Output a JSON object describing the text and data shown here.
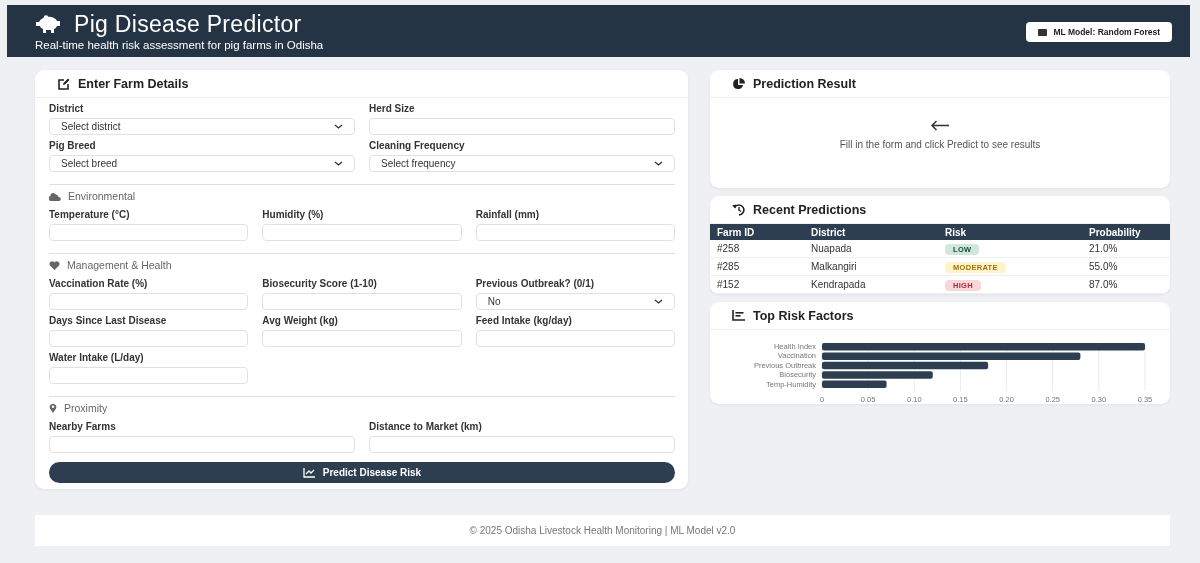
{
  "header": {
    "title": "Pig Disease Predictor",
    "subtitle": "Real-time health risk assessment for pig farms in Odisha",
    "model_badge": "ML Model: Random Forest"
  },
  "form": {
    "title": "Enter Farm Details",
    "sections": [
      {
        "rows": [
          [
            {
              "label": "District",
              "kind": "select",
              "value": "Select district"
            },
            {
              "label": "Herd Size",
              "kind": "input"
            }
          ],
          [
            {
              "label": "Pig Breed",
              "kind": "select",
              "value": "Select breed"
            },
            {
              "label": "Cleaning Frequency",
              "kind": "select",
              "value": "Select frequency"
            }
          ]
        ]
      },
      {
        "title": "Environmental",
        "rows": [
          [
            {
              "label": "Temperature (°C)",
              "kind": "input"
            },
            {
              "label": "Humidity (%)",
              "kind": "input"
            },
            {
              "label": "Rainfall (mm)",
              "kind": "input"
            }
          ]
        ]
      },
      {
        "title": "Management & Health",
        "rows": [
          [
            {
              "label": "Vaccination Rate (%)",
              "kind": "input"
            },
            {
              "label": "Biosecurity Score (1-10)",
              "kind": "input"
            },
            {
              "label": "Previous Outbreak? (0/1)",
              "kind": "select",
              "value": "No"
            }
          ],
          [
            {
              "label": "Days Since Last Disease",
              "kind": "input"
            },
            {
              "label": "Avg Weight (kg)",
              "kind": "input"
            },
            {
              "label": "Feed Intake (kg/day)",
              "kind": "input"
            }
          ],
          [
            {
              "label": "Water Intake (L/day)",
              "kind": "input"
            }
          ]
        ]
      },
      {
        "title": "Proximity",
        "rows": [
          [
            {
              "label": "Nearby Farms",
              "kind": "input"
            },
            {
              "label": "Distance to Market (km)",
              "kind": "input"
            }
          ]
        ]
      }
    ],
    "submit": "Predict Disease Risk"
  },
  "result": {
    "title": "Prediction Result",
    "message": "Fill in the form and click Predict to see results"
  },
  "recent": {
    "title": "Recent Predictions",
    "columns": [
      "Farm ID",
      "District",
      "Risk",
      "Probability"
    ],
    "rows": [
      {
        "farm_id": "#258",
        "district": "Nuapada",
        "risk": "LOW",
        "kind": "low",
        "probability": "21.0%"
      },
      {
        "farm_id": "#285",
        "district": "Malkangiri",
        "risk": "MODERATE",
        "kind": "moderate",
        "probability": "55.0%"
      },
      {
        "farm_id": "#152",
        "district": "Kendrapada",
        "risk": "HIGH",
        "kind": "high",
        "probability": "87.0%"
      }
    ]
  },
  "risk_factors": {
    "title": "Top Risk Factors",
    "chart_data": {
      "type": "bar",
      "orientation": "horizontal",
      "categories": [
        "Health Index",
        "Vaccination",
        "Previous Outbreak",
        "Biosecurity",
        "Temp-Humidity"
      ],
      "series": [
        {
          "color": "#2c3e50",
          "values": [
            0.35,
            0.28,
            0.18,
            0.12,
            0.07
          ]
        }
      ],
      "grid": true,
      "xlim": [
        0,
        0.35
      ],
      "xticks": [
        {
          "value": 0,
          "label": "0"
        },
        {
          "value": 0.05,
          "label": "0.05"
        },
        {
          "value": 0.1,
          "label": "0.10"
        },
        {
          "value": 0.15,
          "label": "0.15"
        },
        {
          "value": 0.2,
          "label": "0.20"
        },
        {
          "value": 0.25,
          "label": "0.25"
        },
        {
          "value": 0.3,
          "label": "0.30"
        },
        {
          "value": 0.35,
          "label": "0.35"
        }
      ]
    }
  },
  "footer": "© 2025 Odisha Livestock Health Monitoring | ML Model v2.0"
}
